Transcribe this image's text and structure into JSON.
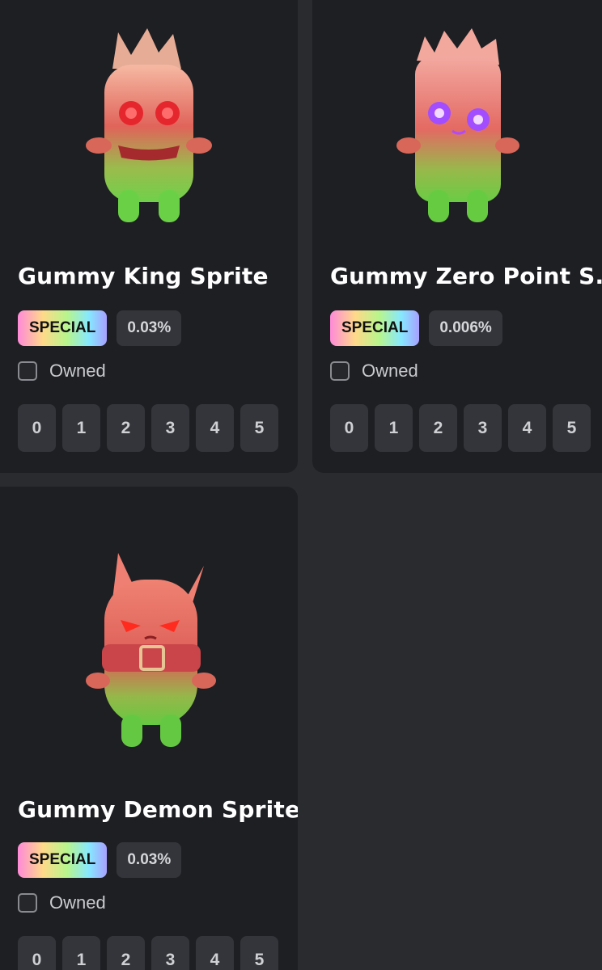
{
  "items": [
    {
      "name": "Gummy King Sprite",
      "badge": "SPECIAL",
      "rate": "0.03%",
      "owned_label": "Owned",
      "counts": [
        "0",
        "1",
        "2",
        "3",
        "4",
        "5"
      ]
    },
    {
      "name": "Gummy Zero Point S...",
      "badge": "SPECIAL",
      "rate": "0.006%",
      "owned_label": "Owned",
      "counts": [
        "0",
        "1",
        "2",
        "3",
        "4",
        "5"
      ]
    },
    {
      "name": "Gummy Demon Sprite",
      "badge": "SPECIAL",
      "rate": "0.03%",
      "owned_label": "Owned",
      "counts": [
        "0",
        "1",
        "2",
        "3",
        "4",
        "5"
      ]
    }
  ]
}
